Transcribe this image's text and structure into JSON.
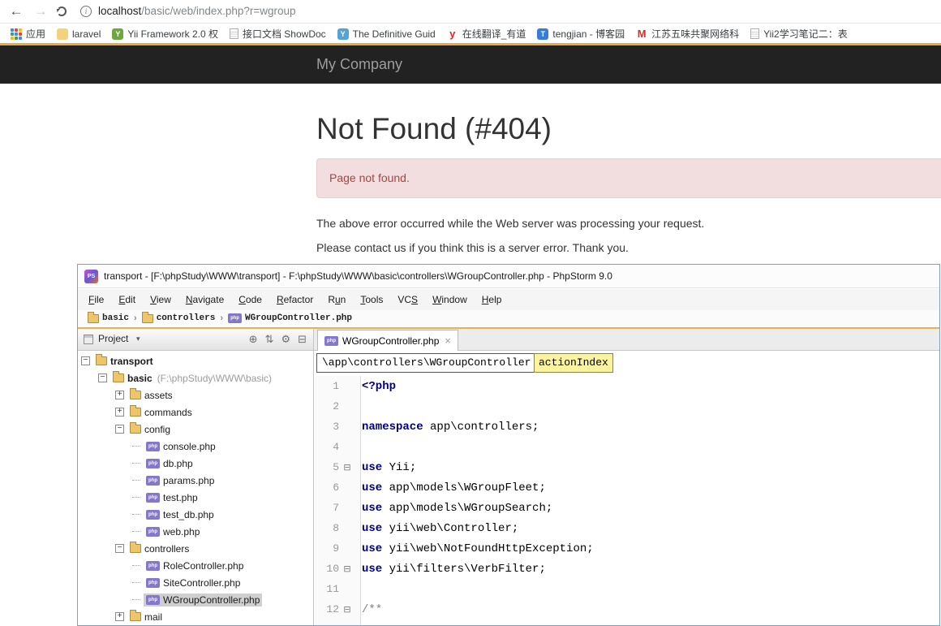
{
  "browser": {
    "url": {
      "host": "localhost",
      "path": "/basic/web/index.php?r=wgroup"
    },
    "bookmarks": [
      {
        "label": "应用",
        "icon_style": "grid",
        "letter": "",
        "color": ""
      },
      {
        "label": "laravel",
        "icon_style": "solid",
        "letter": "",
        "color": "#f0d37c"
      },
      {
        "label": "Yii Framework 2.0 权",
        "icon_style": "solid",
        "letter": "Y",
        "color": "#6fa63f"
      },
      {
        "label": "接口文档 ShowDoc",
        "icon_style": "page",
        "letter": "",
        "color": ""
      },
      {
        "label": "The Definitive Guid",
        "icon_style": "solid",
        "letter": "Y",
        "color": "#52a3d9"
      },
      {
        "label": "在线翻译_有道",
        "icon_style": "plain",
        "letter": "y",
        "color": "#e02222"
      },
      {
        "label": "tengjian - 博客园",
        "icon_style": "solid",
        "letter": "T",
        "color": "#3a7bd5"
      },
      {
        "label": "江苏五味共聚网络科",
        "icon_style": "plain",
        "letter": "M",
        "color": "#d93025"
      },
      {
        "label": "Yii2学习笔记二：表",
        "icon_style": "page",
        "letter": "",
        "color": ""
      }
    ]
  },
  "site": {
    "brand": "My Company",
    "error_title": "Not Found (#404)",
    "alert_text": "Page not found.",
    "message_1": "The above error occurred while the Web server was processing your request.",
    "message_2": "Please contact us if you think this is a server error. Thank you."
  },
  "ide": {
    "window_title": "transport - [F:\\phpStudy\\WWW\\transport] - F:\\phpStudy\\WWW\\basic\\controllers\\WGroupController.php - PhpStorm 9.0",
    "logo_text": "PS",
    "menu": [
      {
        "label": "File",
        "m": 0
      },
      {
        "label": "Edit",
        "m": 0
      },
      {
        "label": "View",
        "m": 0
      },
      {
        "label": "Navigate",
        "m": 0
      },
      {
        "label": "Code",
        "m": 0
      },
      {
        "label": "Refactor",
        "m": 0
      },
      {
        "label": "Run",
        "m": 1
      },
      {
        "label": "Tools",
        "m": 0
      },
      {
        "label": "VCS",
        "m": 2
      },
      {
        "label": "Window",
        "m": 0
      },
      {
        "label": "Help",
        "m": 0
      }
    ],
    "breadcrumb_separator": "›",
    "breadcrumbs": [
      {
        "label": "basic",
        "icon": "folder"
      },
      {
        "label": "controllers",
        "icon": "folder"
      },
      {
        "label": "WGroupController.php",
        "icon": "php"
      }
    ],
    "project_panel": {
      "title": "Project",
      "caret": "▾",
      "icons": [
        {
          "name": "locate-icon",
          "glyph": "⊕"
        },
        {
          "name": "collapse-all-icon",
          "glyph": "⇅"
        },
        {
          "name": "settings-gear-icon",
          "glyph": "⚙"
        },
        {
          "name": "hide-panel-icon",
          "glyph": "⊟"
        }
      ]
    },
    "tab": {
      "label": "WGroupController.php",
      "close": "×"
    },
    "nav_box_left": "\\app\\controllers\\WGroupController",
    "nav_box_right": "actionIndex",
    "tree": [
      {
        "label": "transport",
        "type": "folder",
        "level": 0,
        "expander": "minus",
        "bold": true
      },
      {
        "label": "basic",
        "note": "(F:\\phpStudy\\WWW\\basic)",
        "type": "folder",
        "level": 1,
        "expander": "minus",
        "bold": true
      },
      {
        "label": "assets",
        "type": "folder",
        "level": 2,
        "expander": "plus"
      },
      {
        "label": "commands",
        "type": "folder",
        "level": 2,
        "expander": "plus"
      },
      {
        "label": "config",
        "type": "folder",
        "level": 2,
        "expander": "minus"
      },
      {
        "label": "console.php",
        "type": "php",
        "level": 3
      },
      {
        "label": "db.php",
        "type": "php",
        "level": 3
      },
      {
        "label": "params.php",
        "type": "php",
        "level": 3
      },
      {
        "label": "test.php",
        "type": "php",
        "level": 3
      },
      {
        "label": "test_db.php",
        "type": "php",
        "level": 3
      },
      {
        "label": "web.php",
        "type": "php",
        "level": 3
      },
      {
        "label": "controllers",
        "type": "folder",
        "level": 2,
        "expander": "minus"
      },
      {
        "label": "RoleController.php",
        "type": "php",
        "level": 3
      },
      {
        "label": "SiteController.php",
        "type": "php",
        "level": 3
      },
      {
        "label": "WGroupController.php",
        "type": "php",
        "level": 3,
        "selected": true
      },
      {
        "label": "mail",
        "type": "folder",
        "level": 2,
        "expander": "plus"
      }
    ],
    "code": [
      {
        "n": "1",
        "tokens": [
          {
            "t": "<?php",
            "c": "kw"
          }
        ]
      },
      {
        "n": "2",
        "tokens": []
      },
      {
        "n": "3",
        "tokens": [
          {
            "t": "namespace",
            "c": "kw"
          },
          {
            "t": " app\\controllers;",
            "c": "pl"
          }
        ]
      },
      {
        "n": "4",
        "tokens": []
      },
      {
        "n": "5",
        "fold": true,
        "tokens": [
          {
            "t": "use",
            "c": "kw"
          },
          {
            "t": " Yii;",
            "c": "pl"
          }
        ]
      },
      {
        "n": "6",
        "tokens": [
          {
            "t": "use",
            "c": "kw"
          },
          {
            "t": " app\\models\\WGroupFleet;",
            "c": "pl"
          }
        ]
      },
      {
        "n": "7",
        "tokens": [
          {
            "t": "use",
            "c": "kw"
          },
          {
            "t": " app\\models\\WGroupSearch;",
            "c": "pl"
          }
        ]
      },
      {
        "n": "8",
        "tokens": [
          {
            "t": "use",
            "c": "kw"
          },
          {
            "t": " yii\\web\\Controller;",
            "c": "pl"
          }
        ]
      },
      {
        "n": "9",
        "tokens": [
          {
            "t": "use",
            "c": "kw"
          },
          {
            "t": " yii\\web\\NotFoundHttpException;",
            "c": "pl"
          }
        ]
      },
      {
        "n": "10",
        "fold": true,
        "tokens": [
          {
            "t": "use",
            "c": "kw"
          },
          {
            "t": " yii\\filters\\VerbFilter;",
            "c": "pl"
          }
        ]
      },
      {
        "n": "11",
        "tokens": []
      },
      {
        "n": "12",
        "fold": true,
        "tokens": [
          {
            "t": "/**",
            "c": "cm"
          }
        ]
      }
    ]
  }
}
